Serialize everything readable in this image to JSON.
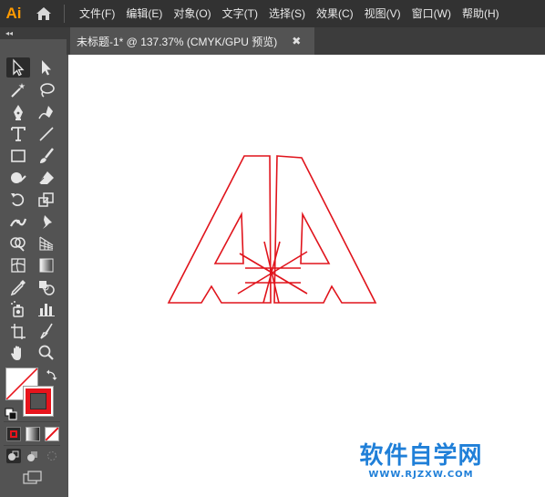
{
  "app": {
    "logo": "Ai"
  },
  "menu": {
    "items": [
      {
        "label": "文件(F)"
      },
      {
        "label": "编辑(E)"
      },
      {
        "label": "对象(O)"
      },
      {
        "label": "文字(T)"
      },
      {
        "label": "选择(S)"
      },
      {
        "label": "效果(C)"
      },
      {
        "label": "视图(V)"
      },
      {
        "label": "窗口(W)"
      },
      {
        "label": "帮助(H)"
      }
    ]
  },
  "toolbar": {
    "grip": "◂◂",
    "tools": [
      "selection-tool",
      "direct-selection-tool",
      "magic-wand-tool",
      "lasso-tool",
      "pen-tool",
      "curvature-tool",
      "type-tool",
      "line-segment-tool",
      "rectangle-tool",
      "paintbrush-tool",
      "shaper-tool",
      "eraser-tool",
      "rotate-tool",
      "scale-tool",
      "width-tool",
      "puppet-warp-tool",
      "shape-builder-tool",
      "perspective-grid-tool",
      "mesh-tool",
      "gradient-tool",
      "eyedropper-tool",
      "blend-tool",
      "symbol-sprayer-tool",
      "column-graph-tool",
      "artboard-tool",
      "slice-tool",
      "hand-tool",
      "zoom-tool"
    ],
    "fill_color": "#ffffff",
    "stroke_color": "#e8141c"
  },
  "document": {
    "tab_title": "未标题-1* @ 137.37% (CMYK/GPU 预览)",
    "close": "✖"
  },
  "canvas": {
    "artwork_stroke": "#e0141c",
    "watermark_main": "软件自学网",
    "watermark_url": "WWW.RJZXW.COM"
  }
}
